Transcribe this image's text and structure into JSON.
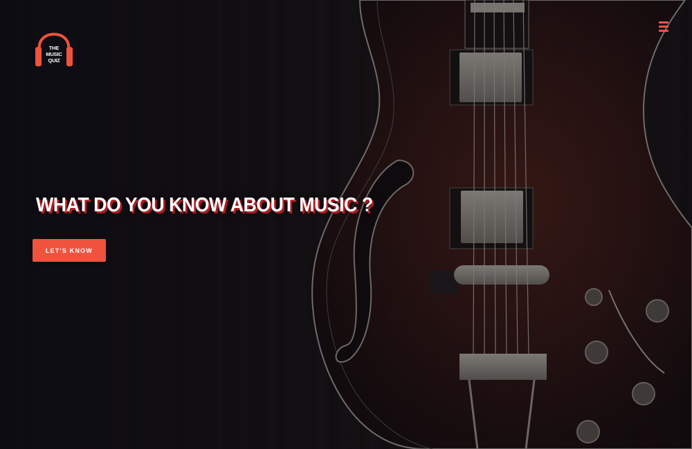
{
  "brand": {
    "logo_line1": "THE",
    "logo_line2": "MUSIC",
    "logo_line3": "QUIZ",
    "accent_color": "#f0533d"
  },
  "nav": {
    "menu_icon": "hamburger-menu-icon"
  },
  "hero": {
    "headline": "WHAT DO YOU KNOW ABOUT MUSIC ?",
    "cta_label": "LET'S KNOW",
    "background_image": "electric-guitar-photo"
  }
}
